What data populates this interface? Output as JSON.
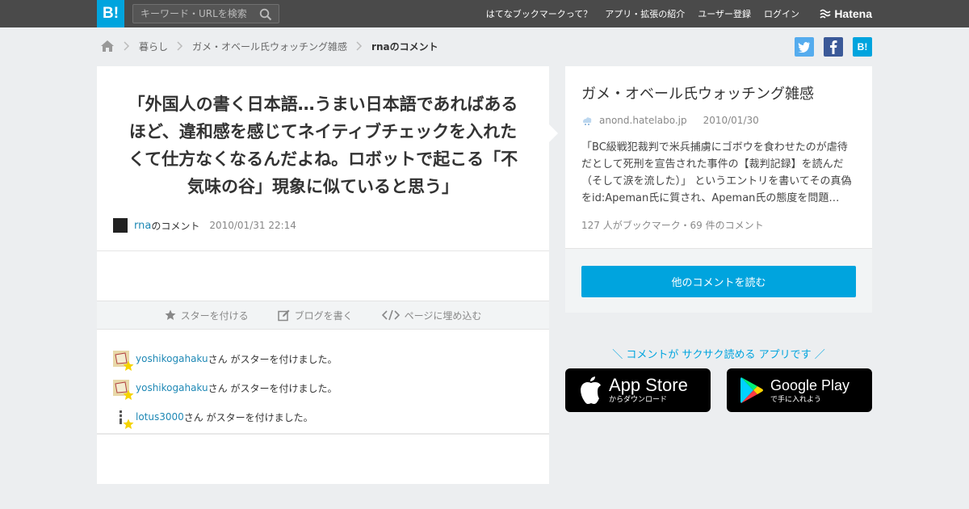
{
  "header": {
    "logo": "B!",
    "search_placeholder": "キーワード・URLを検索",
    "nav": [
      "はてなブックマークって？",
      "アプリ・拡張の紹介",
      "ユーザー登録",
      "ログイン"
    ],
    "brand": "Hatena"
  },
  "breadcrumb": {
    "items": [
      "暮らし",
      "ガメ・オベール氏ウォッチング雑感"
    ],
    "current": "rnaのコメント"
  },
  "share": {
    "twitter": "t",
    "facebook": "f",
    "hatena": "B!"
  },
  "comment": {
    "text": "「外国人の書く日本語…うまい日本語であればあるほど、違和感を感じてネイティブチェックを入れたくて仕方なくなるんだよね。ロボットで起こる「不気味の谷」現象に似ていると思う」",
    "user": "rna",
    "suffix": "のコメント",
    "timestamp": "2010/01/31 22:14"
  },
  "actions": {
    "star": "スターを付ける",
    "blog": "ブログを書く",
    "embed": "ページに埋め込む"
  },
  "stars": [
    {
      "user": "yoshikogahaku",
      "text": "さん がスターを付けました。"
    },
    {
      "user": "yoshikogahaku",
      "text": "さん がスターを付けました。"
    },
    {
      "user": "lotus3000",
      "text": "さん がスターを付けました。"
    }
  ],
  "entry": {
    "title": "ガメ・オベール氏ウォッチング雑感",
    "domain": "anond.hatelabo.jp",
    "date": "2010/01/30",
    "excerpt": "「BC級戦犯裁判で米兵捕虜にゴボウを食わせたのが虐待だとして死刑を宣告された事件の【裁判記録】を読んだ（そして涙を流した）」 というエントリを書いてその真偽をid:Apeman氏に質され、Apeman氏の態度を問題…",
    "stats": "127 人がブックマーク・69 件のコメント",
    "button": "他のコメントを読む"
  },
  "apps": {
    "tagline": "＼ コメントが サクサク読める アプリです ／",
    "appstore_big": "App Store",
    "appstore_small": "からダウンロード",
    "googleplay_big": "Google Play",
    "googleplay_small": "で手に入れよう"
  },
  "colors": {
    "accent": "#00a4de",
    "header": "#4a4a4a",
    "link": "#1e88b5",
    "background": "#eceef0"
  }
}
